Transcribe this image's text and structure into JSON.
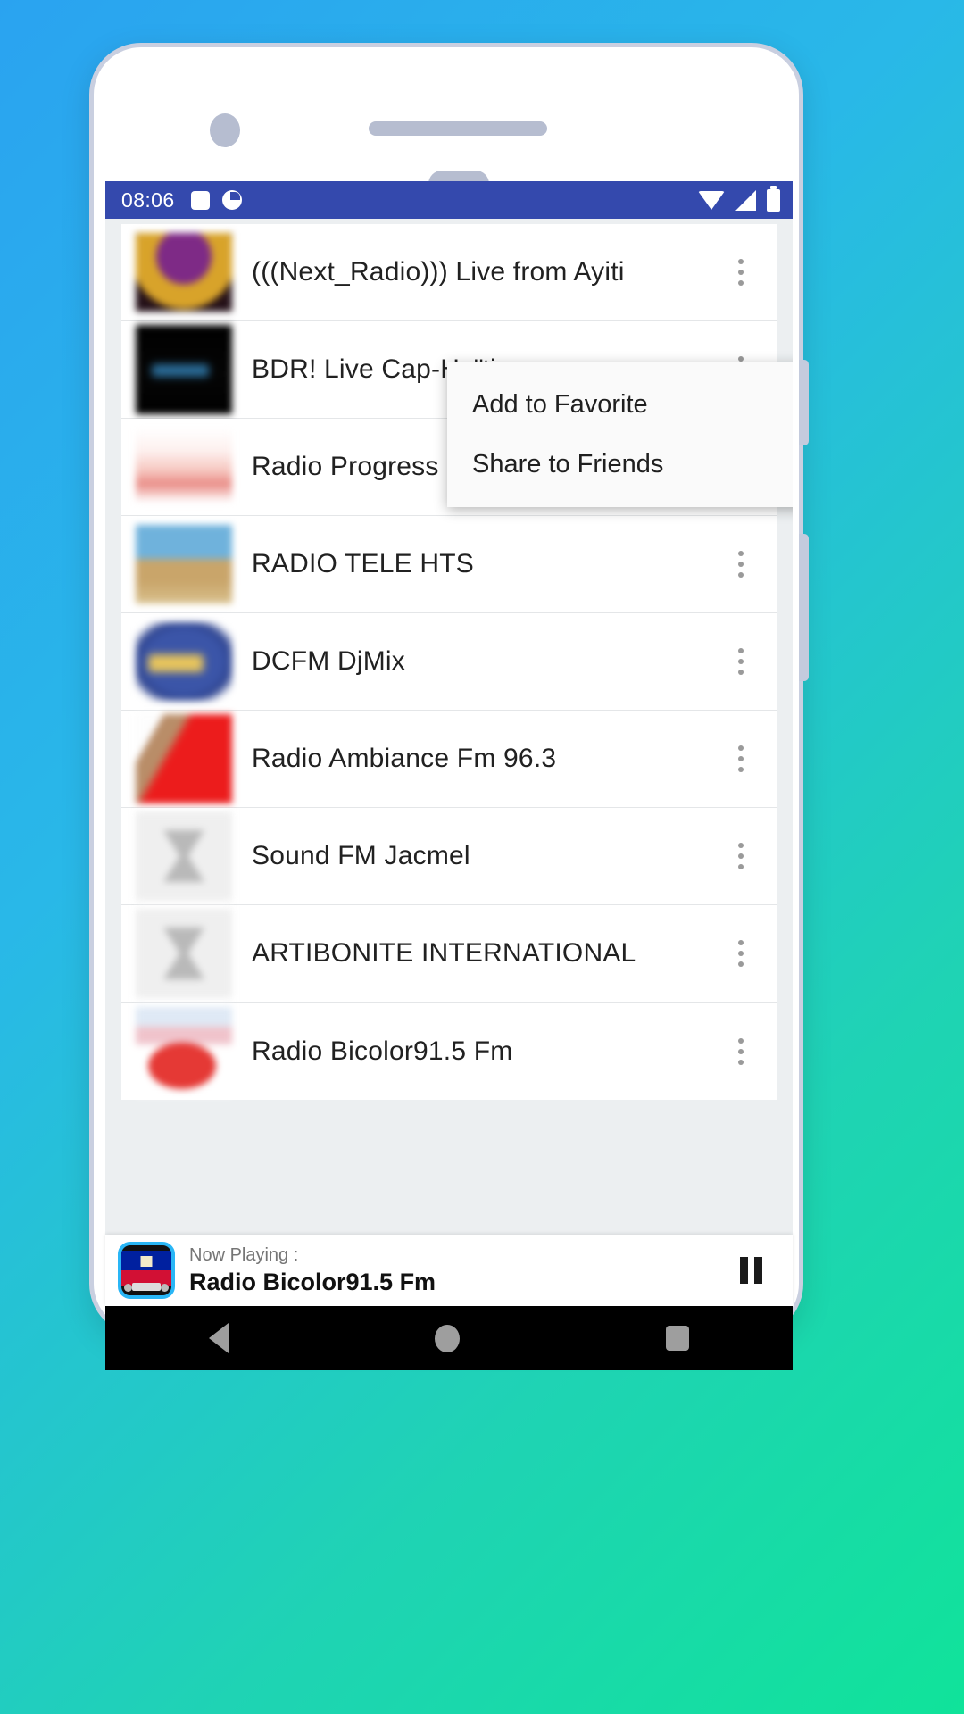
{
  "theme": {
    "bg_gradient_start": "#2aa3f0",
    "bg_gradient_end": "#10e39a",
    "statusbar_color": "#3449ad",
    "accent": "#29b6f6"
  },
  "statusbar": {
    "time": "08:06",
    "left_icons": [
      "square-notification-icon",
      "circle-notification-icon"
    ],
    "right_icons": [
      "wifi-icon",
      "signal-icon",
      "battery-icon"
    ]
  },
  "stations": [
    {
      "name": "(((Next_Radio))) Live from Ayiti",
      "art": "art1"
    },
    {
      "name": "BDR! Live Cap-Haïtien",
      "art": "art2"
    },
    {
      "name": "Radio Progress",
      "art": "art3"
    },
    {
      "name": "RADIO TELE HTS",
      "art": "art4"
    },
    {
      "name": "DCFM DjMix",
      "art": "art5"
    },
    {
      "name": "Radio Ambiance Fm 96.3",
      "art": "art6"
    },
    {
      "name": "Sound FM Jacmel",
      "art": "art7"
    },
    {
      "name": "ARTIBONITE INTERNATIONAL",
      "art": "art7"
    },
    {
      "name": "Radio Bicolor91.5 Fm",
      "art": "art8"
    }
  ],
  "popup_menu": {
    "items": [
      {
        "label": "Add to Favorite"
      },
      {
        "label": "Share to Friends"
      }
    ]
  },
  "now_playing": {
    "label": "Now Playing :",
    "title": "Radio Bicolor91.5 Fm",
    "control": "pause-button"
  },
  "navbar": {
    "back": "back-button",
    "home": "home-button",
    "recents": "recents-button"
  }
}
